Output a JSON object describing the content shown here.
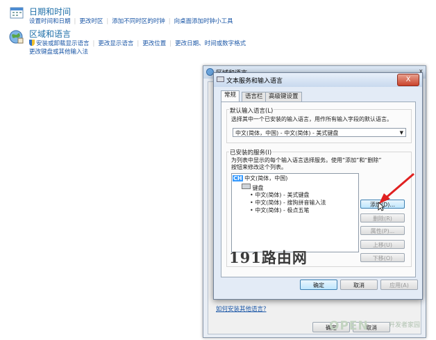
{
  "control_panel": {
    "datetime": {
      "title": "日期和时间",
      "links": [
        "设置时间和日期",
        "更改时区",
        "添加不同时区的时钟",
        "向桌面添加时钟小工具"
      ]
    },
    "region": {
      "title": "区域和语言",
      "links": [
        "安装或卸载显示语言",
        "更改显示语言",
        "更改位置",
        "更改日期、时间或数字格式"
      ],
      "links2": [
        "更改键盘或其他输入法"
      ]
    }
  },
  "outer_dialog": {
    "title": "区域和语言",
    "close": "x",
    "help_link": "如何安装其他语言?",
    "ok": "确定",
    "cancel": "取消"
  },
  "inner_dialog": {
    "title": "文本服务和输入语言",
    "close": "X",
    "tabs": [
      "常规",
      "语言栏",
      "高级键设置"
    ],
    "default_lang_group": "默认输入语言(L)",
    "default_lang_desc": "选择其中一个已安装的输入语言，用作所有输入字段的默认语言。",
    "default_lang_value": "中文(简体，中国) - 中文(简体) - 美式键盘",
    "installed_group": "已安装的服务(I)",
    "installed_desc1": "为列表中显示的每个输入语言选择服务。使用“添加”和“删除”",
    "installed_desc2": "按钮来修改这个列表。",
    "tree": {
      "lang_badge": "CH",
      "lang": "中文(简体，中国)",
      "keyboard": "键盘",
      "items": [
        "中文(简体) - 美式键盘",
        "中文(简体) - 搜狗拼音输入法",
        "中文(简体) - 极点五笔"
      ]
    },
    "buttons": {
      "add": "添加(D)...",
      "remove": "删除(R)",
      "properties": "属性(P)...",
      "move_up": "上移(U)",
      "move_down": "下移(O)"
    },
    "footer": {
      "ok": "确定",
      "cancel": "取消",
      "apply": "应用(A)"
    }
  },
  "watermark": {
    "text": "191路由网",
    "logo": "OPEN",
    "logo_suffix": "开发者家园"
  },
  "colors": {
    "link": "#1a56a6",
    "title": "#1e6fa8",
    "arrow": "#e02020",
    "selection": "#3399ff"
  }
}
